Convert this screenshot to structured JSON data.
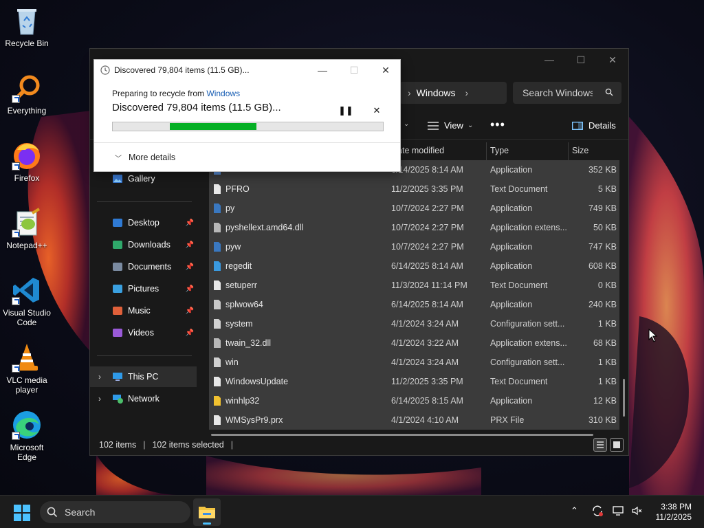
{
  "desktop": {
    "icons": [
      {
        "label": "Recycle Bin",
        "icon": "recycle-bin-icon"
      },
      {
        "label": "Everything",
        "icon": "everything-search-icon"
      },
      {
        "label": "Firefox",
        "icon": "firefox-icon"
      },
      {
        "label": "Notepad++",
        "icon": "notepadpp-icon"
      },
      {
        "label": "Visual Studio Code",
        "icon": "vscode-icon"
      },
      {
        "label": "VLC media player",
        "icon": "vlc-icon"
      },
      {
        "label": "Microsoft Edge",
        "icon": "edge-icon"
      }
    ]
  },
  "explorer": {
    "address_current": "Windows",
    "search_placeholder": "Search Windows",
    "toolbar": {
      "view_label": "View",
      "details_label": "Details"
    },
    "columns": {
      "date": "Date modified",
      "type": "Type",
      "size": "Size"
    },
    "nav": {
      "gallery": "Gallery",
      "quick_access": [
        {
          "label": "Desktop",
          "icon": "desktop-icon"
        },
        {
          "label": "Downloads",
          "icon": "downloads-icon"
        },
        {
          "label": "Documents",
          "icon": "documents-icon"
        },
        {
          "label": "Pictures",
          "icon": "pictures-icon"
        },
        {
          "label": "Music",
          "icon": "music-icon"
        },
        {
          "label": "Videos",
          "icon": "videos-icon"
        }
      ],
      "this_pc": "This PC",
      "network": "Network"
    },
    "files": [
      {
        "name": "",
        "date": "6/14/2025 8:14 AM",
        "type": "Application",
        "size": "352 KB",
        "icon": "app-icon"
      },
      {
        "name": "PFRO",
        "date": "11/2/2025 3:35 PM",
        "type": "Text Document",
        "size": "5 KB",
        "icon": "text-doc-icon"
      },
      {
        "name": "py",
        "date": "10/7/2024 2:27 PM",
        "type": "Application",
        "size": "749 KB",
        "icon": "python-icon"
      },
      {
        "name": "pyshellext.amd64.dll",
        "date": "10/7/2024 2:27 PM",
        "type": "Application extens...",
        "size": "50 KB",
        "icon": "dll-icon"
      },
      {
        "name": "pyw",
        "date": "10/7/2024 2:27 PM",
        "type": "Application",
        "size": "747 KB",
        "icon": "python-icon"
      },
      {
        "name": "regedit",
        "date": "6/14/2025 8:14 AM",
        "type": "Application",
        "size": "608 KB",
        "icon": "regedit-icon"
      },
      {
        "name": "setuperr",
        "date": "11/3/2024 11:14 PM",
        "type": "Text Document",
        "size": "0 KB",
        "icon": "text-doc-icon"
      },
      {
        "name": "splwow64",
        "date": "6/14/2025 8:14 AM",
        "type": "Application",
        "size": "240 KB",
        "icon": "printer-icon"
      },
      {
        "name": "system",
        "date": "4/1/2024 3:24 AM",
        "type": "Configuration sett...",
        "size": "1 KB",
        "icon": "config-file-icon"
      },
      {
        "name": "twain_32.dll",
        "date": "4/1/2024 3:22 AM",
        "type": "Application extens...",
        "size": "68 KB",
        "icon": "dll-icon"
      },
      {
        "name": "win",
        "date": "4/1/2024 3:24 AM",
        "type": "Configuration sett...",
        "size": "1 KB",
        "icon": "config-file-icon"
      },
      {
        "name": "WindowsUpdate",
        "date": "11/2/2025 3:35 PM",
        "type": "Text Document",
        "size": "1 KB",
        "icon": "text-doc-icon"
      },
      {
        "name": "winhlp32",
        "date": "6/14/2025 8:15 AM",
        "type": "Application",
        "size": "12 KB",
        "icon": "help-icon"
      },
      {
        "name": "WMSysPr9.prx",
        "date": "4/1/2024 4:10 AM",
        "type": "PRX File",
        "size": "310 KB",
        "icon": "file-icon"
      }
    ],
    "status": {
      "item_count": "102 items",
      "selected_count": "102 items selected"
    }
  },
  "dialog": {
    "title": "Discovered 79,804 items (11.5 GB)...",
    "subtitle_prefix": "Preparing to recycle from ",
    "subtitle_link": "Windows",
    "main_text": "Discovered 79,804 items (11.5 GB)...",
    "progress_start": 0.21,
    "progress_end": 0.53,
    "more_details": "More details",
    "accent": "#06b025"
  },
  "taskbar": {
    "search_label": "Search",
    "time": "3:38 PM",
    "date": "11/2/2025"
  }
}
